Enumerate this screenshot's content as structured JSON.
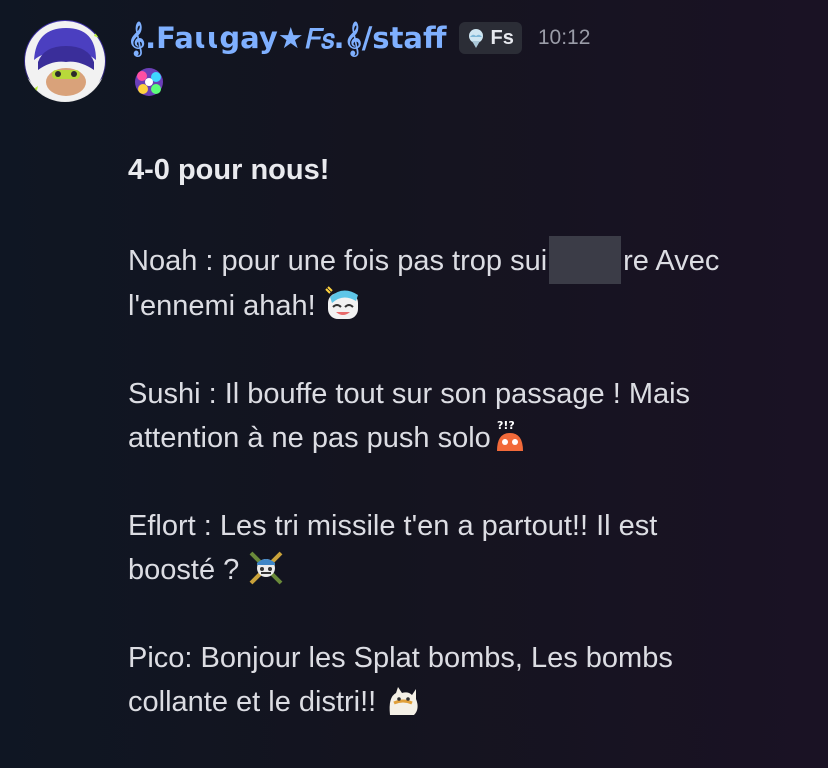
{
  "message": {
    "author": "𝄞.Faɩɩgay★𝘍𝘴.𝄞/staff",
    "tag": {
      "icon": "ice-cream-icon",
      "text": "Fs"
    },
    "time": "10:12",
    "top_sticker": "sparkle-sticker",
    "headline": "4-0 pour nous!",
    "paragraphs": [
      {
        "line1_before": "Noah : pour une fois pas trop sui",
        "line1_after": "re Avec",
        "line2": "l'ennemi ahah!",
        "emoji": "laughing-squid-emoji"
      },
      {
        "line1": "Sushi : Il bouffe tout sur son passage ! Mais",
        "line2": "attention à ne pas push solo",
        "emoji": "confused-octopus-emoji"
      },
      {
        "line1": "Eflort : Les tri missile t'en a partout!! Il est",
        "line2": "boosté ? ",
        "emoji": "crossed-weapons-emoji"
      },
      {
        "line1": "Pico: Bonjour les Splat bombs, Les bombs",
        "line2": "collante et le distri!! ",
        "emoji": "cat-emoji"
      }
    ]
  },
  "colors": {
    "username": "#7fb0ff",
    "text": "#dcdde3",
    "timestamp": "#9a9ca8",
    "tag_bg": "#2b2d36",
    "redaction": "#3b3c47"
  }
}
